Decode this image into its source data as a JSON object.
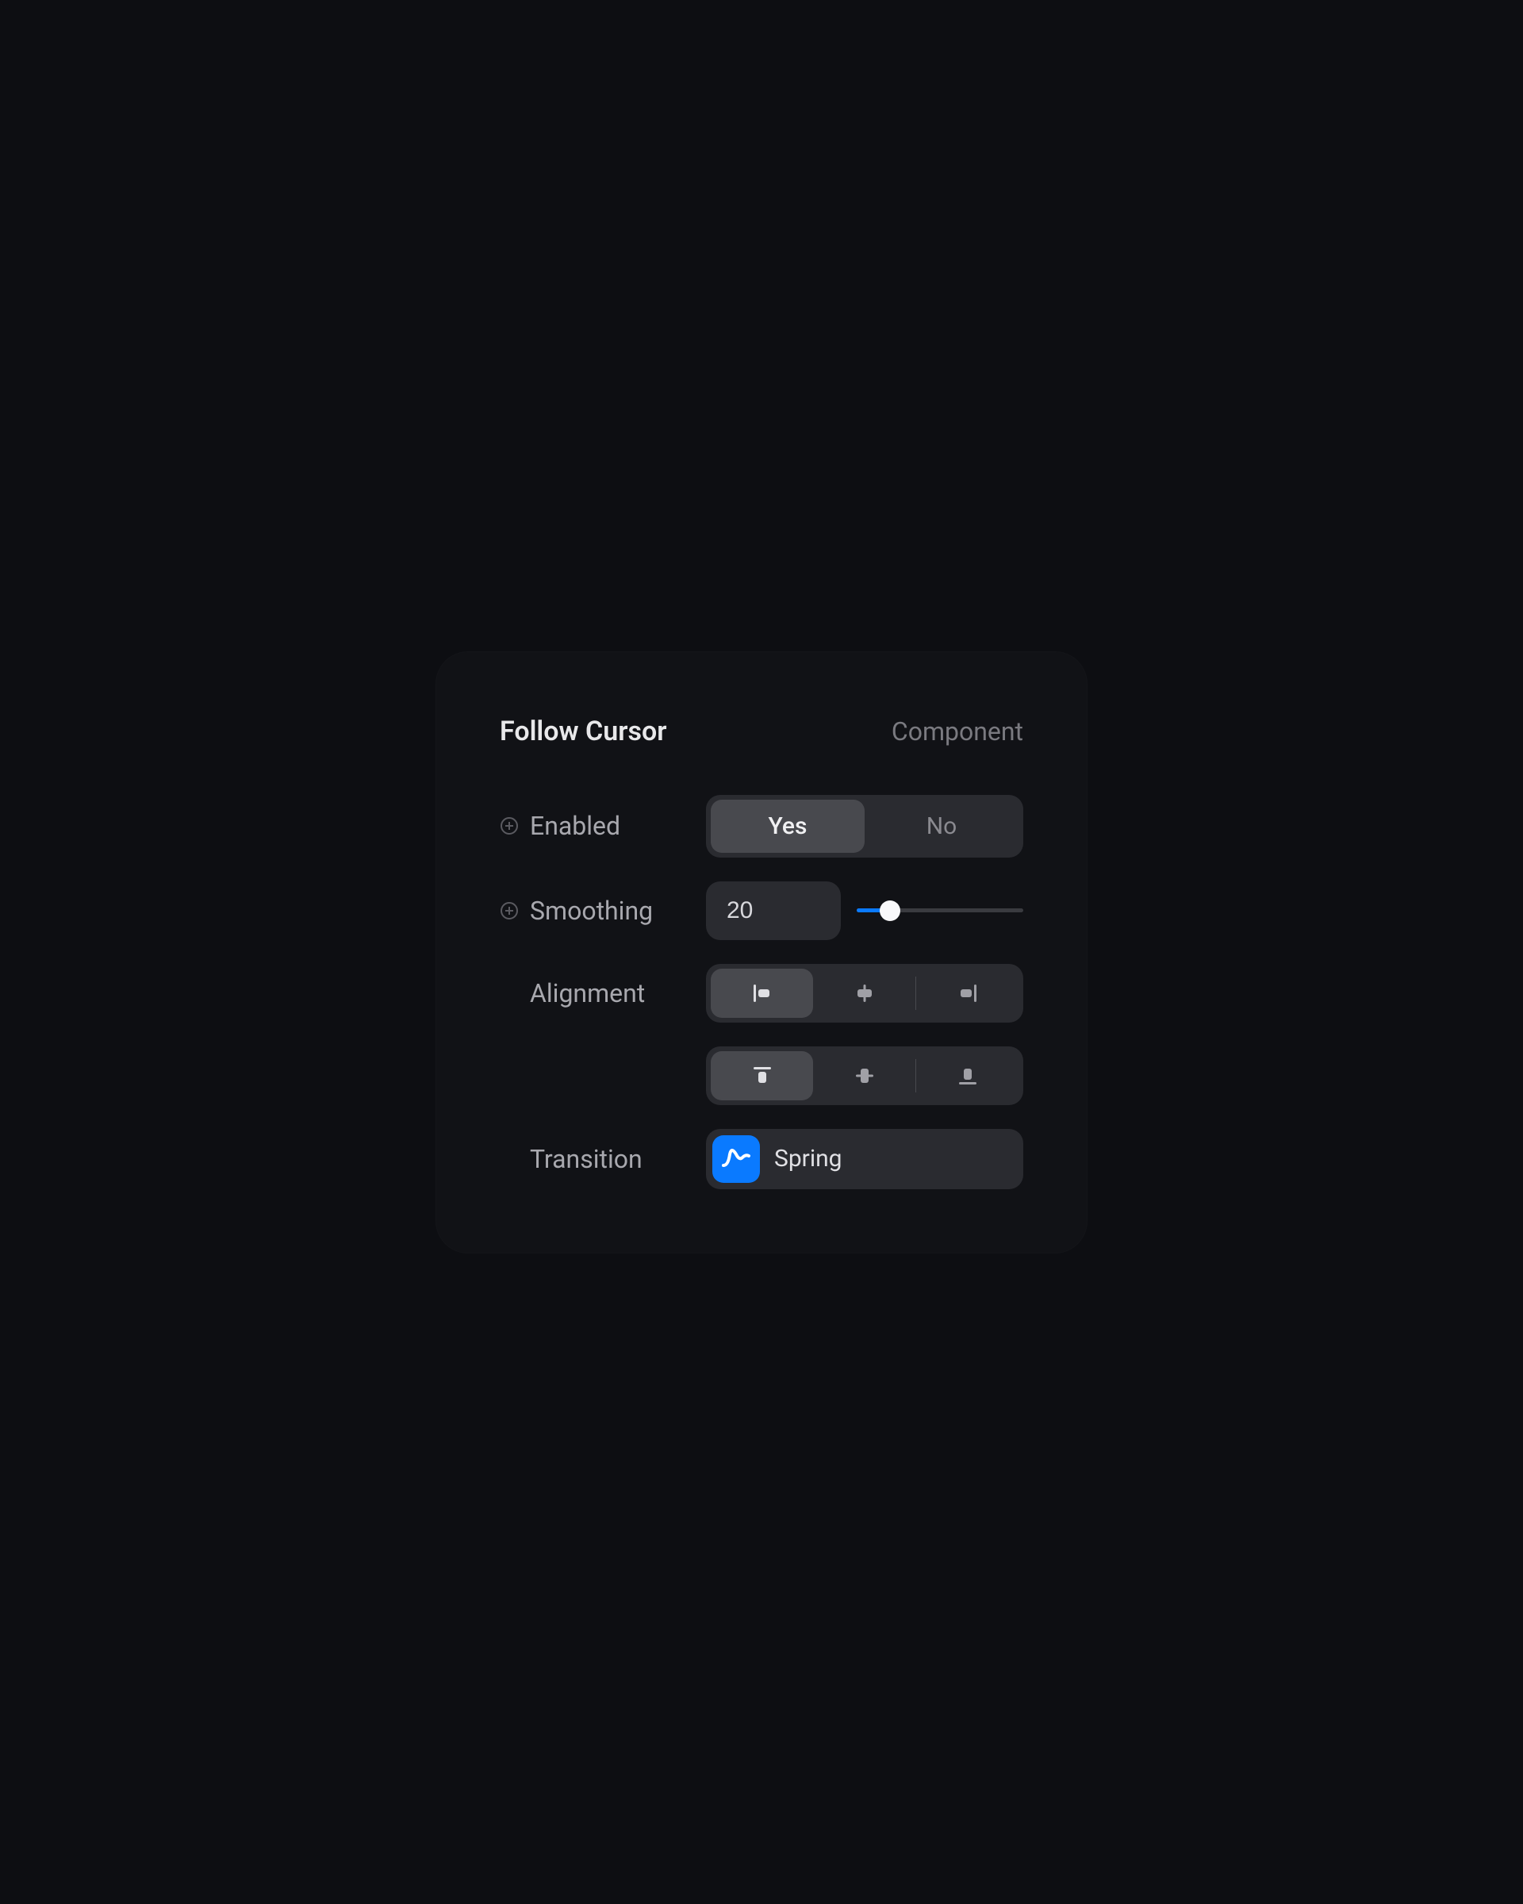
{
  "header": {
    "title": "Follow Cursor",
    "subtitle": "Component"
  },
  "enabled": {
    "label": "Enabled",
    "yes": "Yes",
    "no": "No",
    "value": "Yes"
  },
  "smoothing": {
    "label": "Smoothing",
    "value": "20",
    "slider_percent": 20
  },
  "alignment": {
    "label": "Alignment",
    "horizontal_selected": "left",
    "vertical_selected": "top"
  },
  "transition": {
    "label": "Transition",
    "value": "Spring"
  },
  "colors": {
    "accent": "#0a7aff",
    "panel_bg": "#111216",
    "control_bg": "#2a2b30",
    "control_active": "#48494e"
  }
}
